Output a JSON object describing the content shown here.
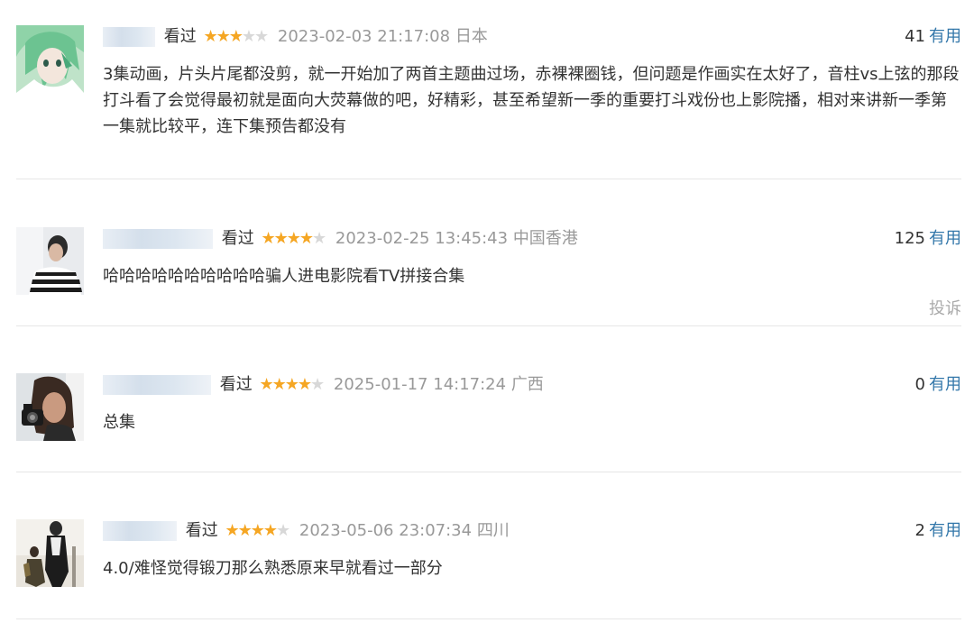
{
  "comments": [
    {
      "watched": "看过",
      "rating": 3,
      "stars_total": 5,
      "time": "2023-02-03 21:17:08",
      "location": "日本",
      "useful_count": "41",
      "useful_label": "有用",
      "content": "3集动画，片头片尾都没剪，就一开始加了两首主题曲过场，赤裸裸圈钱，但问题是作画实在太好了，音柱vs上弦的那段打斗看了会觉得最初就是面向大荧幕做的吧，好精彩，甚至希望新一季的重要打斗戏份也上影院播，相对来讲新一季第一集就比较平，连下集预告都没有",
      "avatar_icon": "anime-girl-avatar"
    },
    {
      "watched": "看过",
      "rating": 4,
      "stars_total": 5,
      "time": "2023-02-25 13:45:43",
      "location": "中国香港",
      "useful_count": "125",
      "useful_label": "有用",
      "content": "哈哈哈哈哈哈哈哈哈哈骗人进电影院看TV拼接合集",
      "report_label": "投诉",
      "avatar_icon": "striped-shirt-person-avatar"
    },
    {
      "watched": "看过",
      "rating": 4,
      "stars_total": 5,
      "time": "2025-01-17 14:17:24",
      "location": "广西",
      "useful_count": "0",
      "useful_label": "有用",
      "content": "总集",
      "avatar_icon": "woman-with-camera-avatar"
    },
    {
      "watched": "看过",
      "rating": 4,
      "stars_total": 5,
      "time": "2023-05-06 23:07:34",
      "location": "四川",
      "useful_count": "2",
      "useful_label": "有用",
      "content": "4.0/难怪觉得锻刀那么熟悉原来早就看过一部分",
      "avatar_icon": "two-people-street-avatar"
    }
  ],
  "colors": {
    "star": "#f5a623",
    "star_empty": "#d8d8d8",
    "link": "#3377aa",
    "muted": "#999999",
    "divider": "#e6e6e6"
  }
}
